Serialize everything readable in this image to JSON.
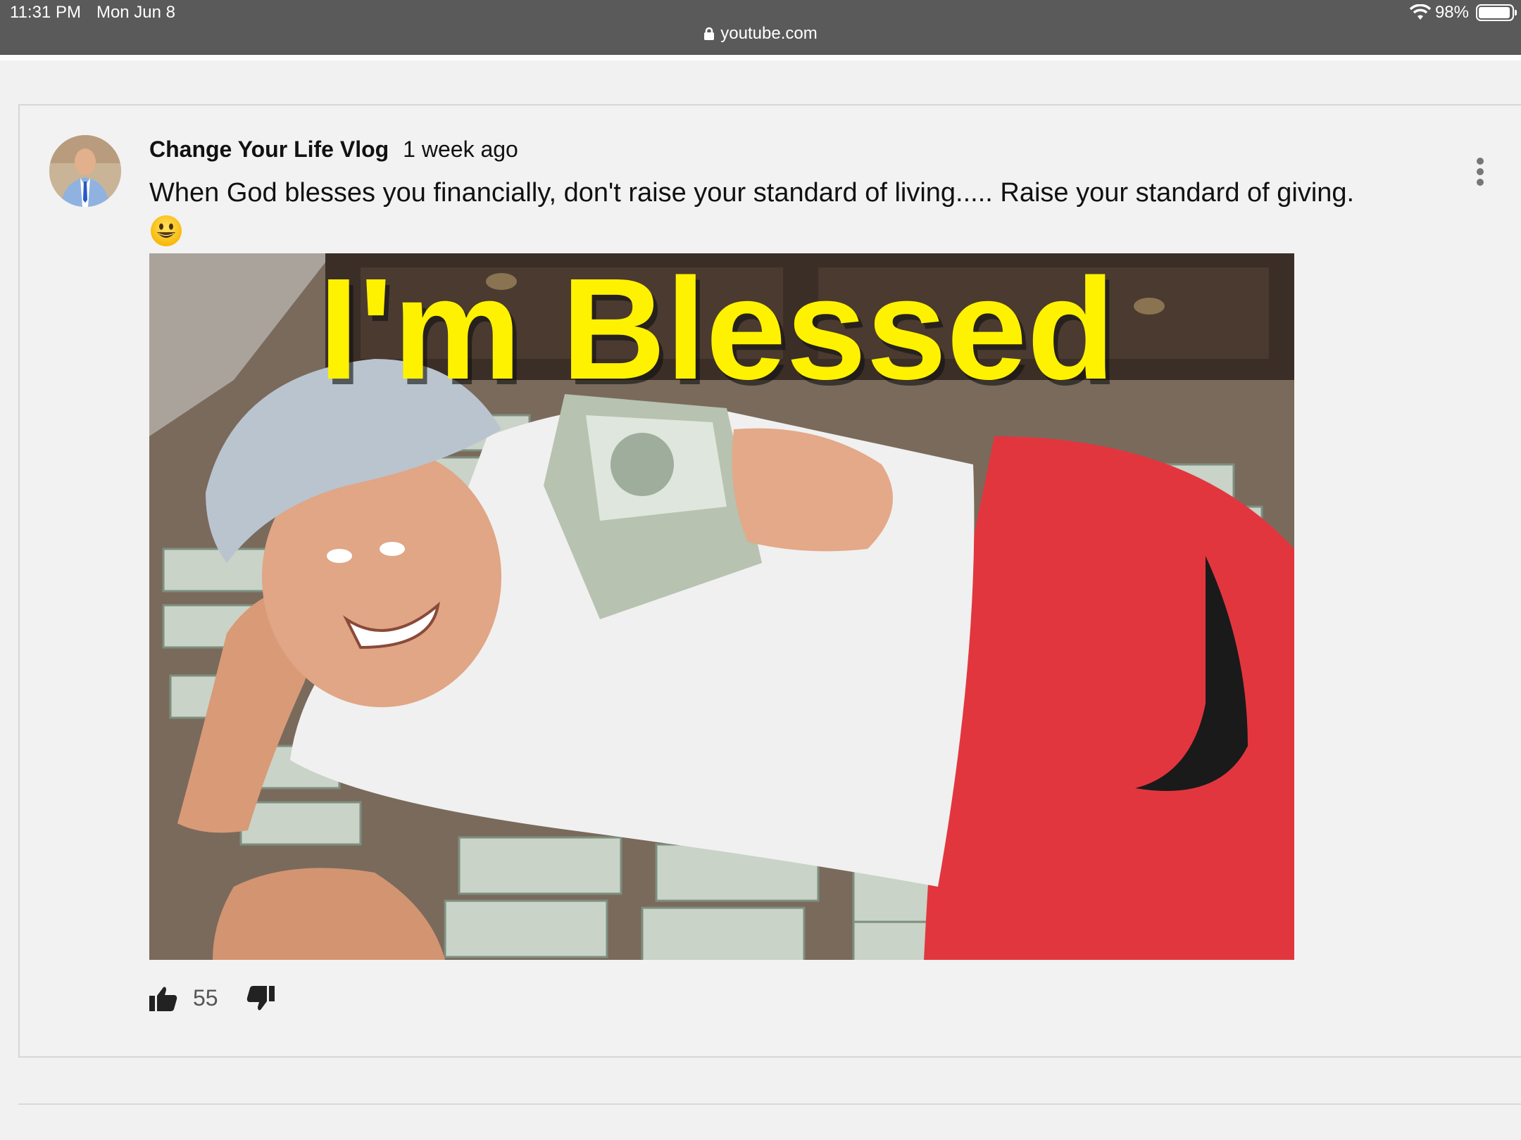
{
  "status_bar": {
    "time": "11:31 PM",
    "date": "Mon Jun 8",
    "battery": "98%",
    "url": "youtube.com"
  },
  "post": {
    "author": "Change Your Life Vlog",
    "time_ago": "1 week ago",
    "text": "When God blesses you financially, don't raise your standard of living..... Raise your standard of giving.",
    "emoji": "grinning-face",
    "image": {
      "headline": "I'm Blessed",
      "headline_color": "#fff200"
    },
    "likes": "55"
  },
  "icons": [
    "lock-icon",
    "wifi-icon",
    "battery-icon",
    "more-vert-icon",
    "thumb-up-icon",
    "thumb-down-icon"
  ]
}
